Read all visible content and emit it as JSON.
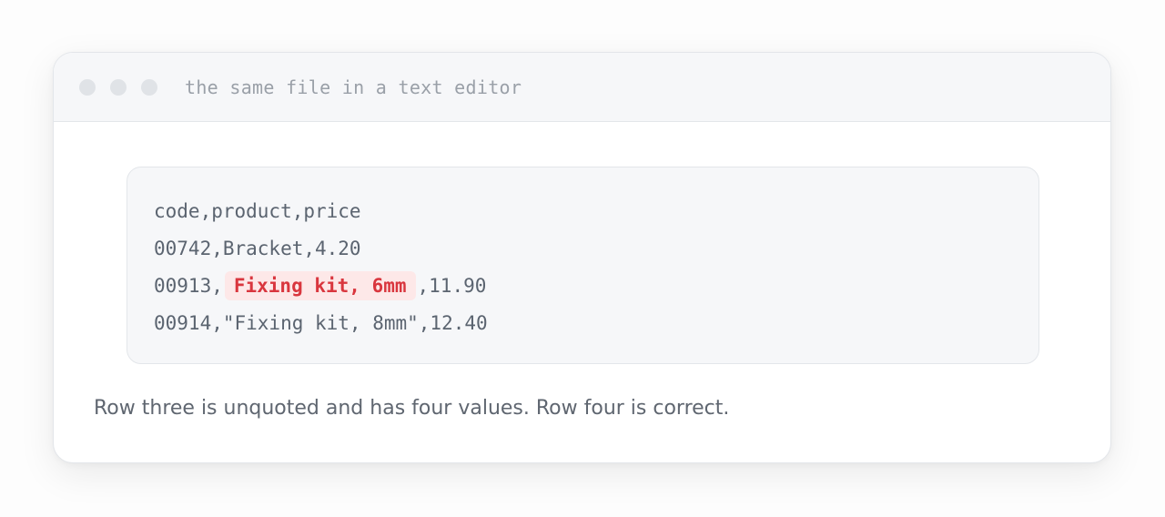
{
  "window": {
    "title": "the same file in a text editor"
  },
  "code": {
    "line1": "code,product,price",
    "line2": "00742,Bracket,4.20",
    "line3_prefix": "00913,",
    "line3_highlight": "Fixing kit, 6mm",
    "line3_suffix": ",11.90",
    "line4": "00914,\"Fixing kit, 8mm\",12.40"
  },
  "caption": "Row three is unquoted and has four values. Row four is correct.",
  "colors": {
    "highlight_text": "#d9363e",
    "highlight_bg": "#fde8e8",
    "code_text": "#5b6470"
  }
}
